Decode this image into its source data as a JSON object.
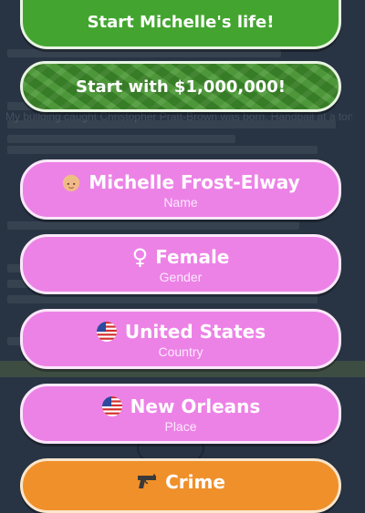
{
  "background": {
    "text": "My building caught Christopher Pratt-Brown was born. Handball at a tony performance during a performance by Michelle in a 2 local my sister Lynette, the couple and the Brandt house of"
  },
  "buttons": {
    "start_life": "Start Michelle's life!",
    "start_million": "Start with $1,000,000!"
  },
  "profile": {
    "name": {
      "value": "Michelle Frost-Elway",
      "label": "Name",
      "icon": "person-face-icon"
    },
    "gender": {
      "value": "Female",
      "label": "Gender",
      "icon": "female-symbol-icon",
      "symbol": "♀"
    },
    "country": {
      "value": "United States",
      "label": "Country",
      "icon": "us-flag-icon"
    },
    "place": {
      "value": "New Orleans",
      "label": "Place",
      "icon": "us-flag-icon"
    }
  },
  "crime": {
    "label": "Crime",
    "icon": "pistol-icon"
  },
  "colors": {
    "green": "#43a530",
    "pink": "#ec82e6",
    "orange": "#f0902a",
    "background": "#283444"
  }
}
